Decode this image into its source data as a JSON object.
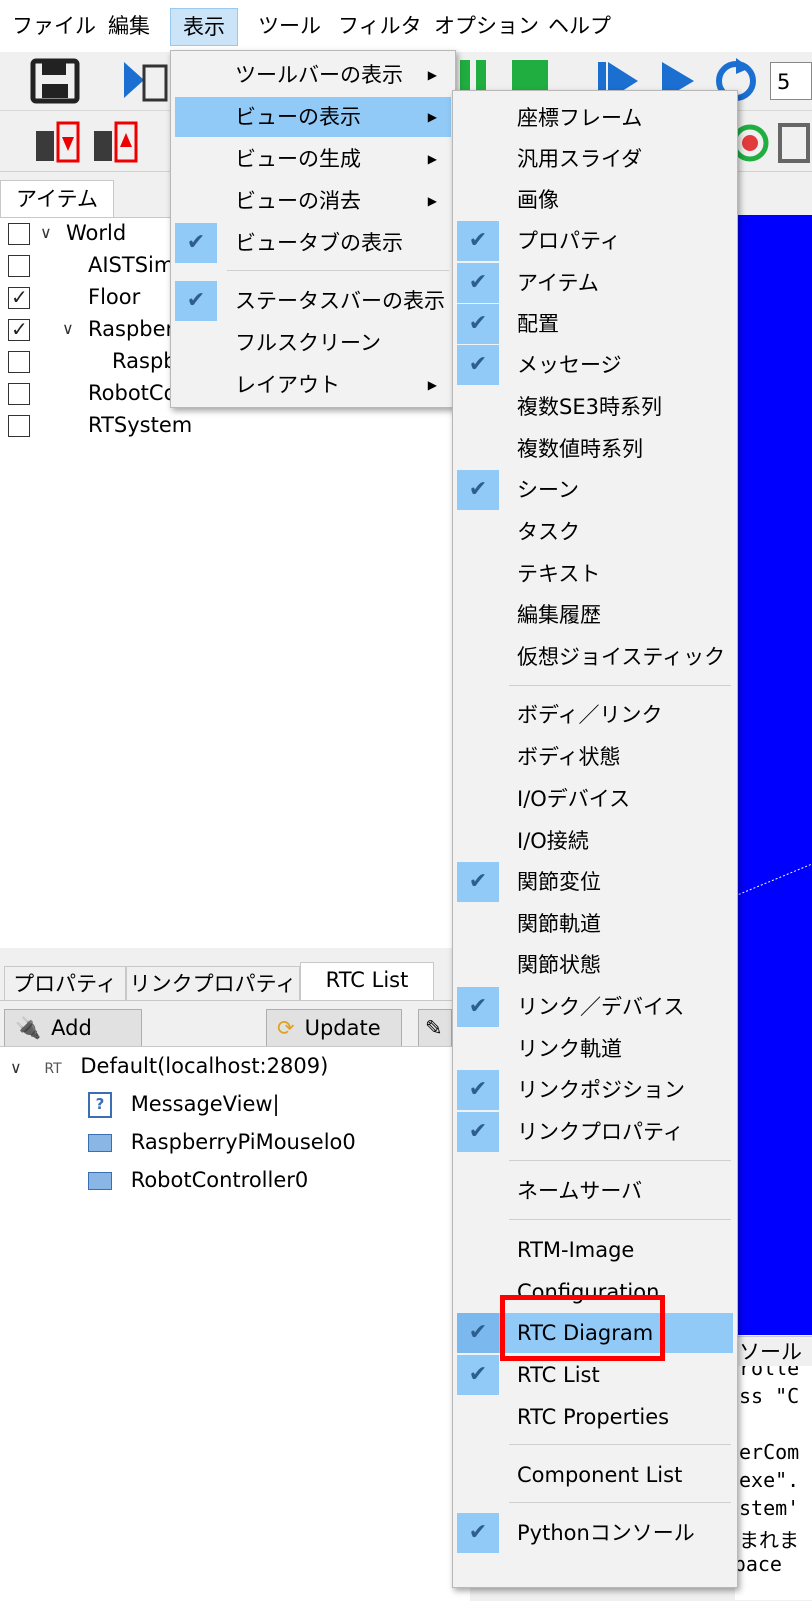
{
  "menubar": {
    "items": [
      "ファイル",
      "編集",
      "表示",
      "ツール",
      "フィルタ",
      "オプション",
      "ヘルプ"
    ]
  },
  "toolbar": {
    "time_field": "5"
  },
  "item_panel": {
    "tab": "アイテム",
    "tree": [
      {
        "label": "World",
        "checked": false
      },
      {
        "label": "AISTSim",
        "checked": false
      },
      {
        "label": "Floor",
        "checked": true
      },
      {
        "label": "Raspber",
        "checked": true
      },
      {
        "label": "Raspb",
        "checked": false
      },
      {
        "label": "RobotCo",
        "checked": false
      },
      {
        "label": "RTSystem",
        "checked": false
      }
    ]
  },
  "bottom_panel": {
    "tabs": [
      "プロパティ",
      "リンクプロパティ",
      "RTC List"
    ],
    "add_label": "Add",
    "update_label": "Update",
    "root_prefix": "RT",
    "root_label": "Default(localhost:2809)",
    "components": [
      "MessageView|",
      "RaspberryPiMouselo0",
      "RobotController0"
    ]
  },
  "console": {
    "tab": "ソール",
    "lines": [
      "rolle",
      "ss \"C",
      "",
      "erCom",
      "exe\".",
      "stem'",
      "まれま",
      "RT-System \"C:\\workspace"
    ]
  },
  "view_menu": {
    "items": [
      {
        "label": "ツールバーの表示",
        "submenu": true,
        "checked": false
      },
      {
        "label": "ビューの表示",
        "submenu": true,
        "checked": false,
        "highlighted": true
      },
      {
        "label": "ビューの生成",
        "submenu": true,
        "checked": false
      },
      {
        "label": "ビューの消去",
        "submenu": true,
        "checked": false
      },
      {
        "label": "ビュータブの表示",
        "submenu": false,
        "checked": true
      },
      {
        "label": "ステータスバーの表示",
        "submenu": false,
        "checked": true
      },
      {
        "label": "フルスクリーン",
        "submenu": false,
        "checked": false
      },
      {
        "label": "レイアウト",
        "submenu": true,
        "checked": false
      }
    ]
  },
  "show_view_submenu": {
    "items": [
      {
        "label": "座標フレーム",
        "checked": false
      },
      {
        "label": "汎用スライダ",
        "checked": false
      },
      {
        "label": "画像",
        "checked": false
      },
      {
        "label": "プロパティ",
        "checked": true
      },
      {
        "label": "アイテム",
        "checked": true
      },
      {
        "label": "配置",
        "checked": true
      },
      {
        "label": "メッセージ",
        "checked": true
      },
      {
        "label": "複数SE3時系列",
        "checked": false
      },
      {
        "label": "複数値時系列",
        "checked": false
      },
      {
        "label": "シーン",
        "checked": true
      },
      {
        "label": "タスク",
        "checked": false
      },
      {
        "label": "テキスト",
        "checked": false
      },
      {
        "label": "編集履歴",
        "checked": false
      },
      {
        "label": "仮想ジョイスティック",
        "checked": false
      },
      {
        "label": "ボディ／リンク",
        "checked": false
      },
      {
        "label": "ボディ状態",
        "checked": false
      },
      {
        "label": "I/Oデバイス",
        "checked": false
      },
      {
        "label": "I/O接続",
        "checked": false
      },
      {
        "label": "関節変位",
        "checked": true
      },
      {
        "label": "関節軌道",
        "checked": false
      },
      {
        "label": "関節状態",
        "checked": false
      },
      {
        "label": "リンク／デバイス",
        "checked": true
      },
      {
        "label": "リンク軌道",
        "checked": false
      },
      {
        "label": "リンクポジション",
        "checked": true
      },
      {
        "label": "リンクプロパティ",
        "checked": true
      },
      {
        "label": "ネームサーバ",
        "checked": false
      },
      {
        "label": "RTM-Image",
        "checked": false
      },
      {
        "label": "Configuration",
        "checked": false
      },
      {
        "label": "RTC Diagram",
        "checked": true,
        "highlighted": true
      },
      {
        "label": "RTC List",
        "checked": true
      },
      {
        "label": "RTC Properties",
        "checked": false
      },
      {
        "label": "Component List",
        "checked": false
      },
      {
        "label": "Pythonコンソール",
        "checked": true
      }
    ]
  },
  "colors": {
    "menu_highlight": "#91c9f7",
    "scene_background": "#0000ff",
    "annotation_box": "#ff0000"
  }
}
